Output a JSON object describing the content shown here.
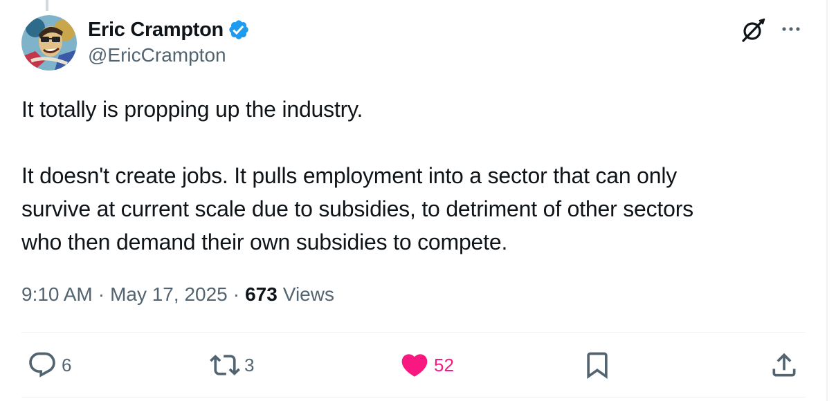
{
  "author": {
    "display_name": "Eric Crampton",
    "handle": "@EricCrampton",
    "verified": true
  },
  "tweet": {
    "paragraphs": [
      "It totally is propping up the industry.",
      "It doesn't create jobs. It pulls employment into a sector that can only survive at current scale due to subsidies, to detriment of other sectors who then demand their own subsidies to compete."
    ],
    "lines": [
      "It doesn't create jobs. It pulls employment into a sector that can only",
      "survive at current scale due to subsidies, to detriment of other sectors",
      "who then demand their own subsidies to compete."
    ]
  },
  "meta": {
    "time": "9:10 AM",
    "separator": "·",
    "date": "May 17, 2025",
    "views_count": "673",
    "views_label": "Views"
  },
  "actions": {
    "replies": "6",
    "retweets": "3",
    "likes": "52",
    "liked": true
  },
  "colors": {
    "text": "#0f1419",
    "secondary": "#536471",
    "verified": "#1d9bf0",
    "like": "#f91880",
    "divider": "#eff3f4"
  },
  "icons": [
    "grok-icon",
    "more-icon",
    "reply-icon",
    "retweet-icon",
    "heart-icon",
    "bookmark-icon",
    "share-icon",
    "verified-badge-icon"
  ]
}
